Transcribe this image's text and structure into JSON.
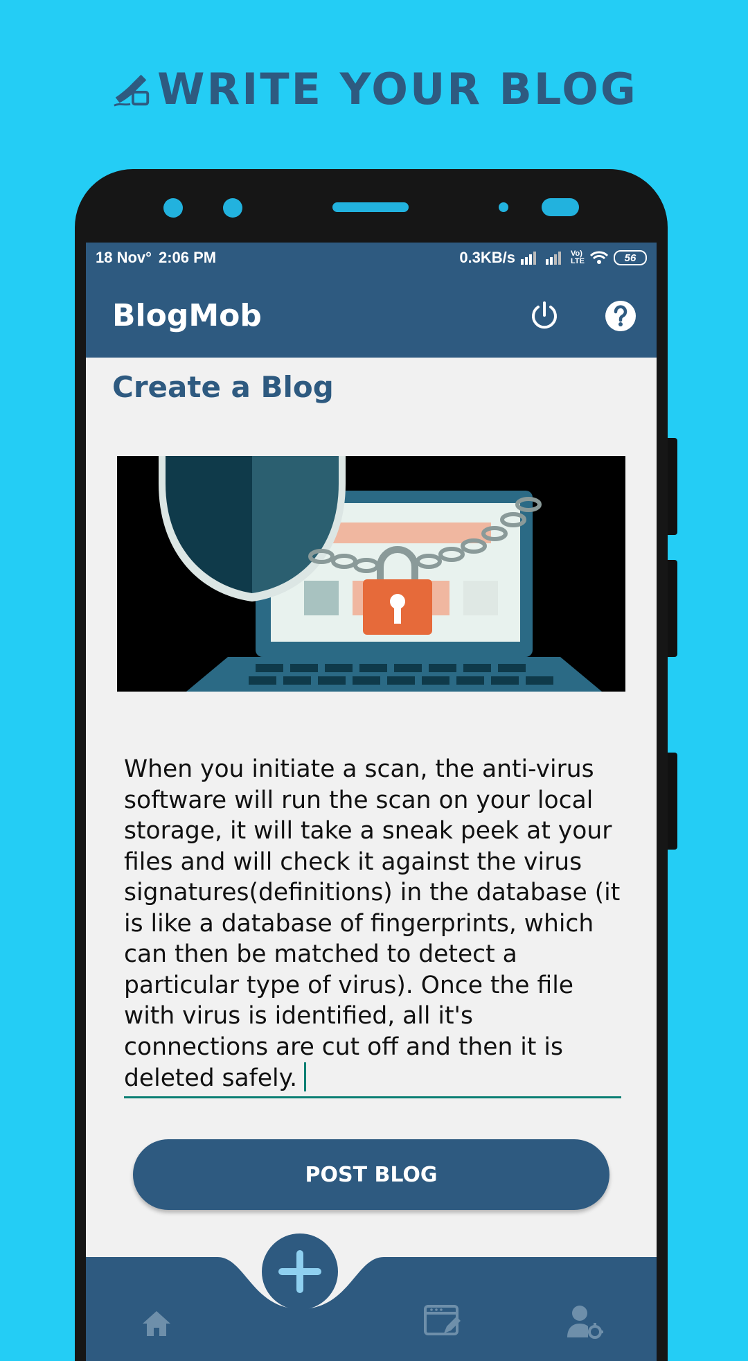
{
  "promo": {
    "title": "WRITE YOUR BLOG",
    "icon": "pen-writing-icon"
  },
  "statusbar": {
    "date": "18 Nov°",
    "time": "2:06 PM",
    "speed": "0.3KB/s",
    "network_label_top": "Vo)",
    "network_label_bottom": "LTE",
    "battery": "56"
  },
  "appbar": {
    "title": "BlogMob",
    "power_icon": "power-icon",
    "help_icon": "help-icon"
  },
  "page": {
    "title": "Create a Blog"
  },
  "blog": {
    "image": "security-laptop-lock-image",
    "text": "When you initiate a scan, the anti-virus software will run the scan on your local storage, it will take a sneak peek at your files and will check it against the virus signatures(definitions) in the database (it is like a database of fingerprints, which can then be matched to detect a particular type of virus). Once the file with virus is identified, all it's connections are cut off and then it is deleted safely."
  },
  "actions": {
    "post_label": "POST BLOG"
  },
  "bottom_nav": {
    "items": [
      "home-icon",
      "add-icon",
      "my-blogs-icon",
      "user-settings-icon"
    ]
  },
  "colors": {
    "background": "#24cdf5",
    "primary": "#2e5a80",
    "accent": "#0a7f73",
    "screen": "#f1f1f1"
  }
}
